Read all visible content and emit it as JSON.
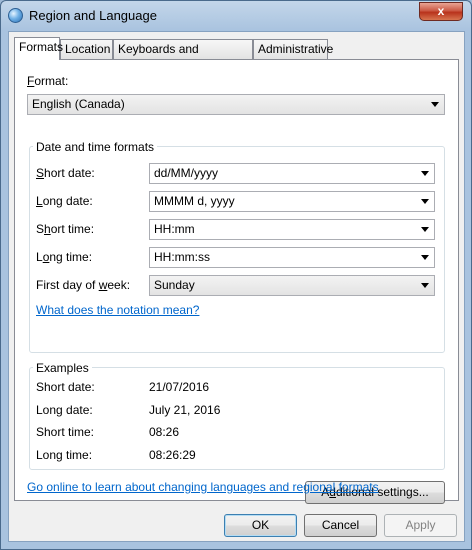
{
  "window": {
    "title": "Region and Language",
    "close_glyph": "x"
  },
  "tabs": [
    "Formats",
    "Location",
    "Keyboards and Languages",
    "Administrative"
  ],
  "format": {
    "label_u": "F",
    "label_rest": "ormat:",
    "value": "English (Canada)"
  },
  "datetime": {
    "title": "Date and time formats",
    "short_date": {
      "label_u": "S",
      "label_rest": "hort date:",
      "value": "dd/MM/yyyy"
    },
    "long_date": {
      "label_u": "L",
      "label_rest": "ong date:",
      "value": "MMMM d, yyyy"
    },
    "short_time": {
      "label_pre": "S",
      "label_u": "h",
      "label_rest": "ort time:",
      "value": "HH:mm"
    },
    "long_time": {
      "label_pre": "L",
      "label_u": "o",
      "label_rest": "ng time:",
      "value": "HH:mm:ss"
    },
    "first_day": {
      "label_pre": "First day of ",
      "label_u": "w",
      "label_rest": "eek:",
      "value": "Sunday"
    },
    "notation_link": "What does the notation mean?"
  },
  "examples": {
    "title": "Examples",
    "rows": [
      {
        "label": "Short date:",
        "value": "21/07/2016"
      },
      {
        "label": "Long date:",
        "value": "July 21, 2016"
      },
      {
        "label": "Short time:",
        "value": "08:26"
      },
      {
        "label": "Long time:",
        "value": "08:26:29"
      }
    ]
  },
  "additional_settings": {
    "pre": "A",
    "u": "d",
    "rest": "ditional settings..."
  },
  "online_link": "Go online to learn about changing languages and regional formats",
  "footer": {
    "ok": "OK",
    "cancel": "Cancel",
    "apply": "Apply"
  }
}
